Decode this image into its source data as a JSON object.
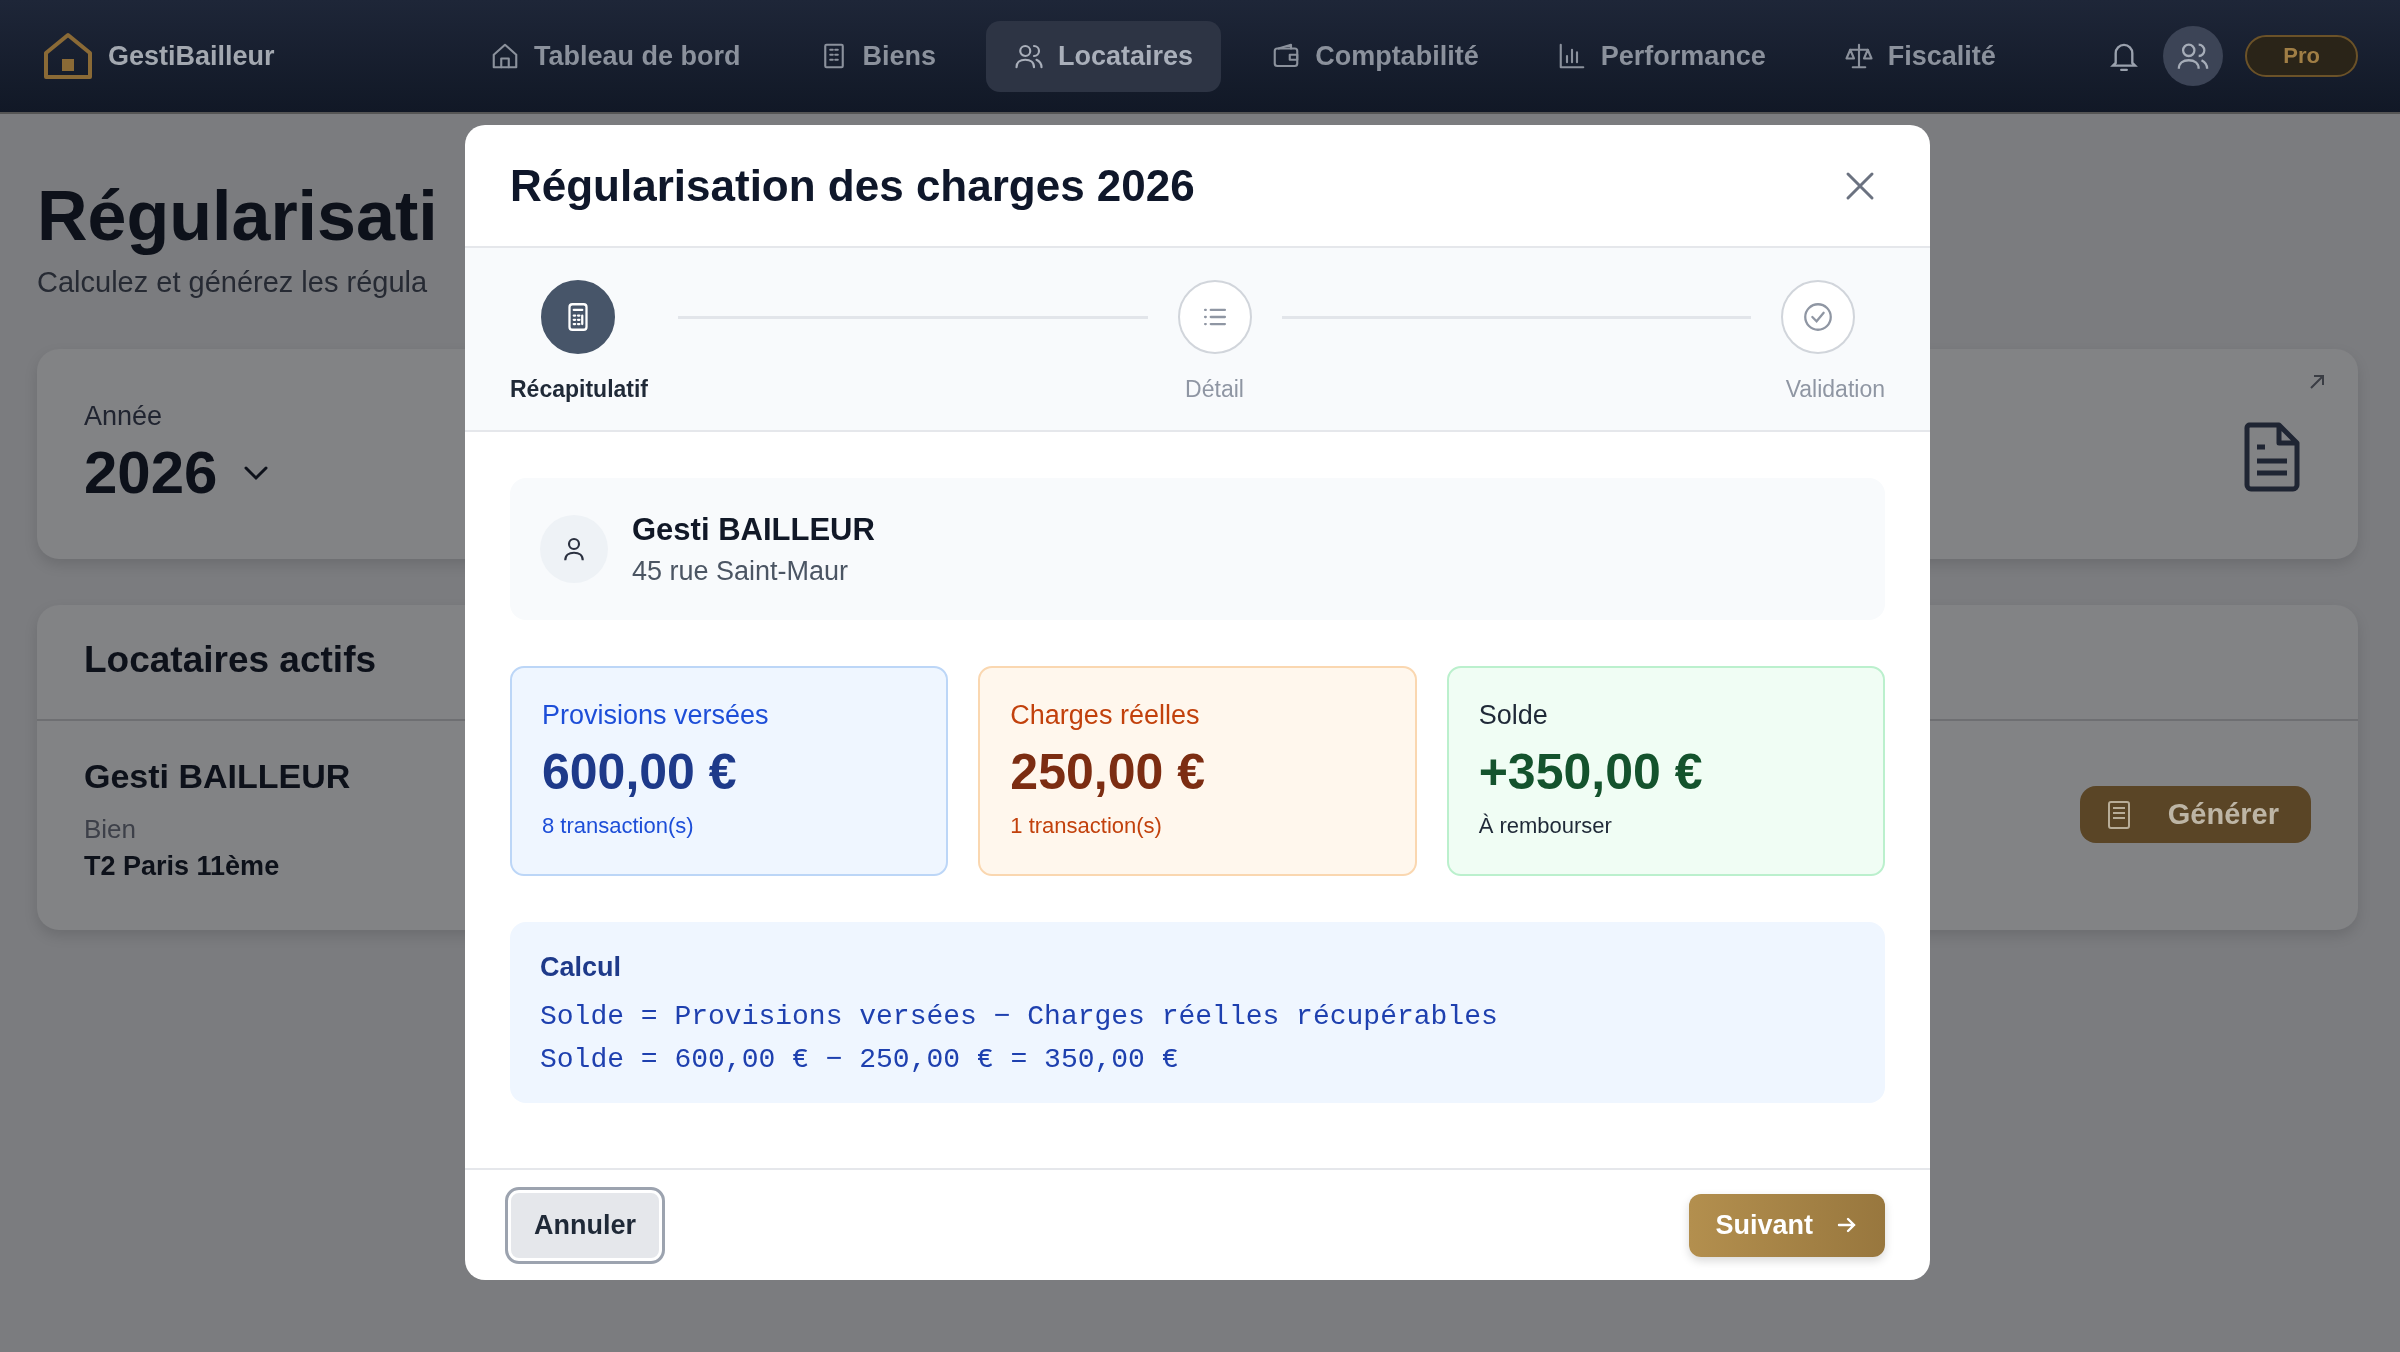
{
  "nav": {
    "brand": "GestiBailleur",
    "items": [
      {
        "label": "Tableau de bord",
        "selected": false
      },
      {
        "label": "Biens",
        "selected": false
      },
      {
        "label": "Locataires",
        "selected": true
      },
      {
        "label": "Comptabilité",
        "selected": false
      },
      {
        "label": "Performance",
        "selected": false
      },
      {
        "label": "Fiscalité",
        "selected": false
      }
    ],
    "plan": "Pro"
  },
  "page": {
    "title": "Régularisati",
    "subtitle": "Calculez et générez les régula",
    "year_card": {
      "label": "Année",
      "value": "2026"
    },
    "tenants_card": {
      "title": "Locataires actifs",
      "tenant": {
        "name": "Gesti BAILLEUR",
        "property_label": "Bien",
        "property": "T2 Paris 11ème"
      },
      "button": "Générer"
    }
  },
  "modal": {
    "title": "Régularisation des charges 2026",
    "steps": [
      {
        "label": "Récapitulatif",
        "selected": true
      },
      {
        "label": "Détail",
        "selected": false
      },
      {
        "label": "Validation",
        "selected": false
      }
    ],
    "tenant": {
      "name": "Gesti BAILLEUR",
      "address": "45 rue Saint-Maur"
    },
    "stats": [
      {
        "kind": "provisions",
        "label": "Provisions versées",
        "value": "600,00 €",
        "note": "8 transaction(s)"
      },
      {
        "kind": "charges",
        "label": "Charges réelles",
        "value": "250,00 €",
        "note": "1 transaction(s)"
      },
      {
        "kind": "balance",
        "label": "Solde",
        "value": "+350,00 €",
        "note": "À rembourser"
      }
    ],
    "calc": {
      "title": "Calcul",
      "lines": [
        "Solde = Provisions versées − Charges réelles récupérables",
        "Solde = 600,00 € − 250,00 € = 350,00 €"
      ]
    },
    "cancel": "Annuler",
    "next": "Suivant"
  }
}
